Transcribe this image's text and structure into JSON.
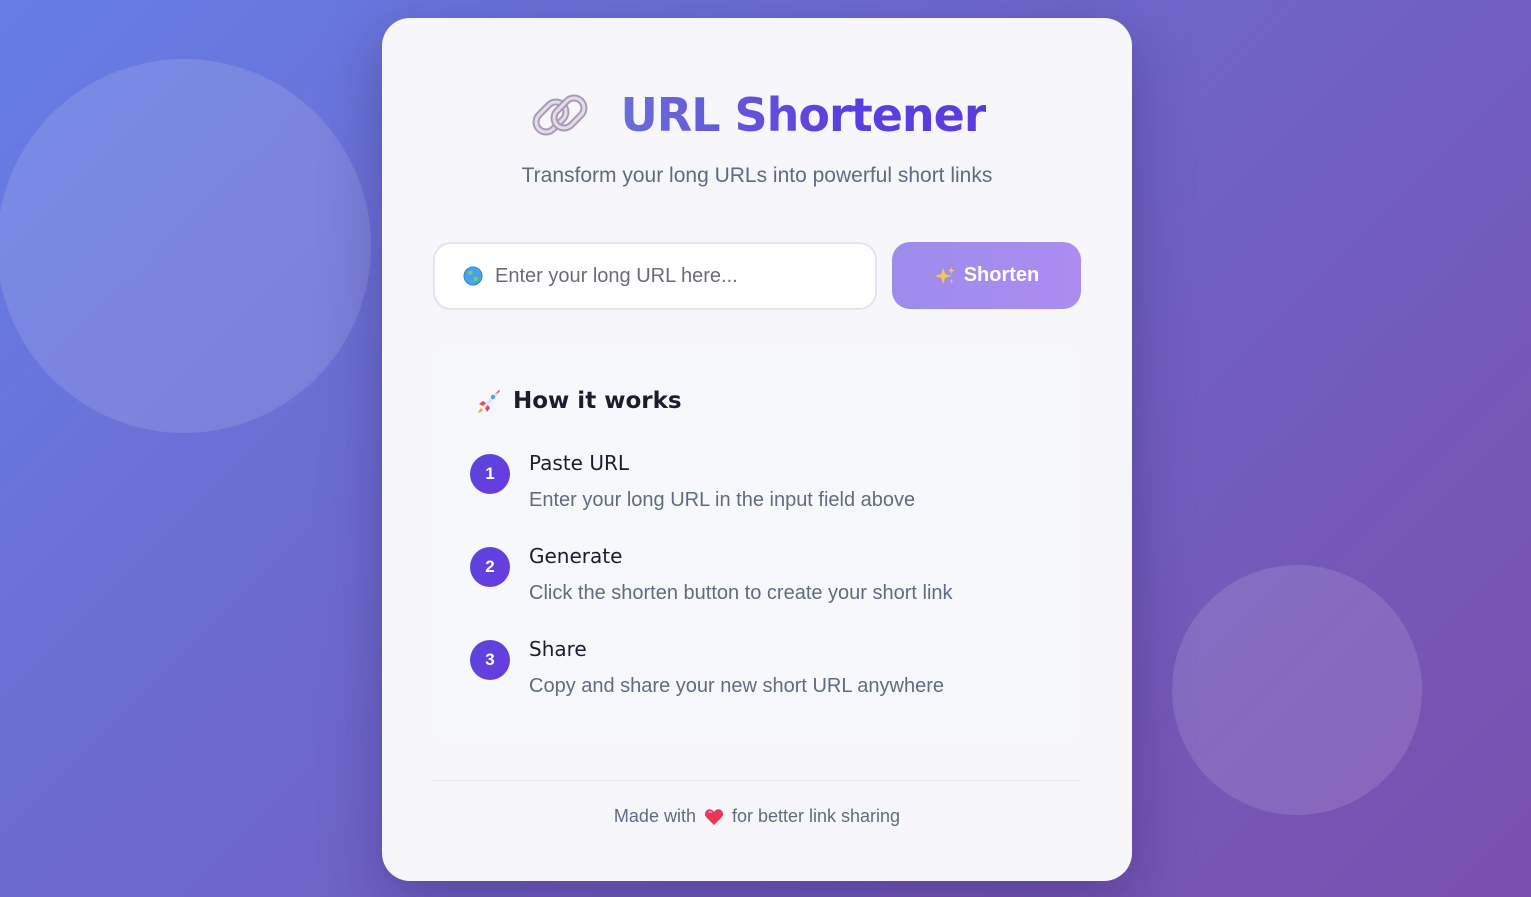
{
  "header": {
    "title": "URL Shortener",
    "subtitle": "Transform your long URLs into powerful short links",
    "icon": "link-icon"
  },
  "form": {
    "input_placeholder": "Enter your long URL here...",
    "input_value": "",
    "input_icon": "globe-icon",
    "button_label": "Shorten",
    "button_icon": "sparkle-icon"
  },
  "how_it_works": {
    "title": "How it works",
    "icon": "rocket-icon",
    "steps": [
      {
        "number": "1",
        "title": "Paste URL",
        "description": "Enter your long URL in the input field above"
      },
      {
        "number": "2",
        "title": "Generate",
        "description": "Click the shorten button to create your short link"
      },
      {
        "number": "3",
        "title": "Share",
        "description": "Copy and share your new short URL anywhere"
      }
    ]
  },
  "footer": {
    "prefix": "Made with",
    "suffix": "for better link sharing",
    "icon": "heart-icon"
  },
  "colors": {
    "accent": "#5b3fe0",
    "button_start": "#9c8ceb",
    "button_end": "#ac8cf0",
    "step_badge": "#5a46dc",
    "background_start": "#667ee6",
    "background_end": "#7a4fae"
  }
}
